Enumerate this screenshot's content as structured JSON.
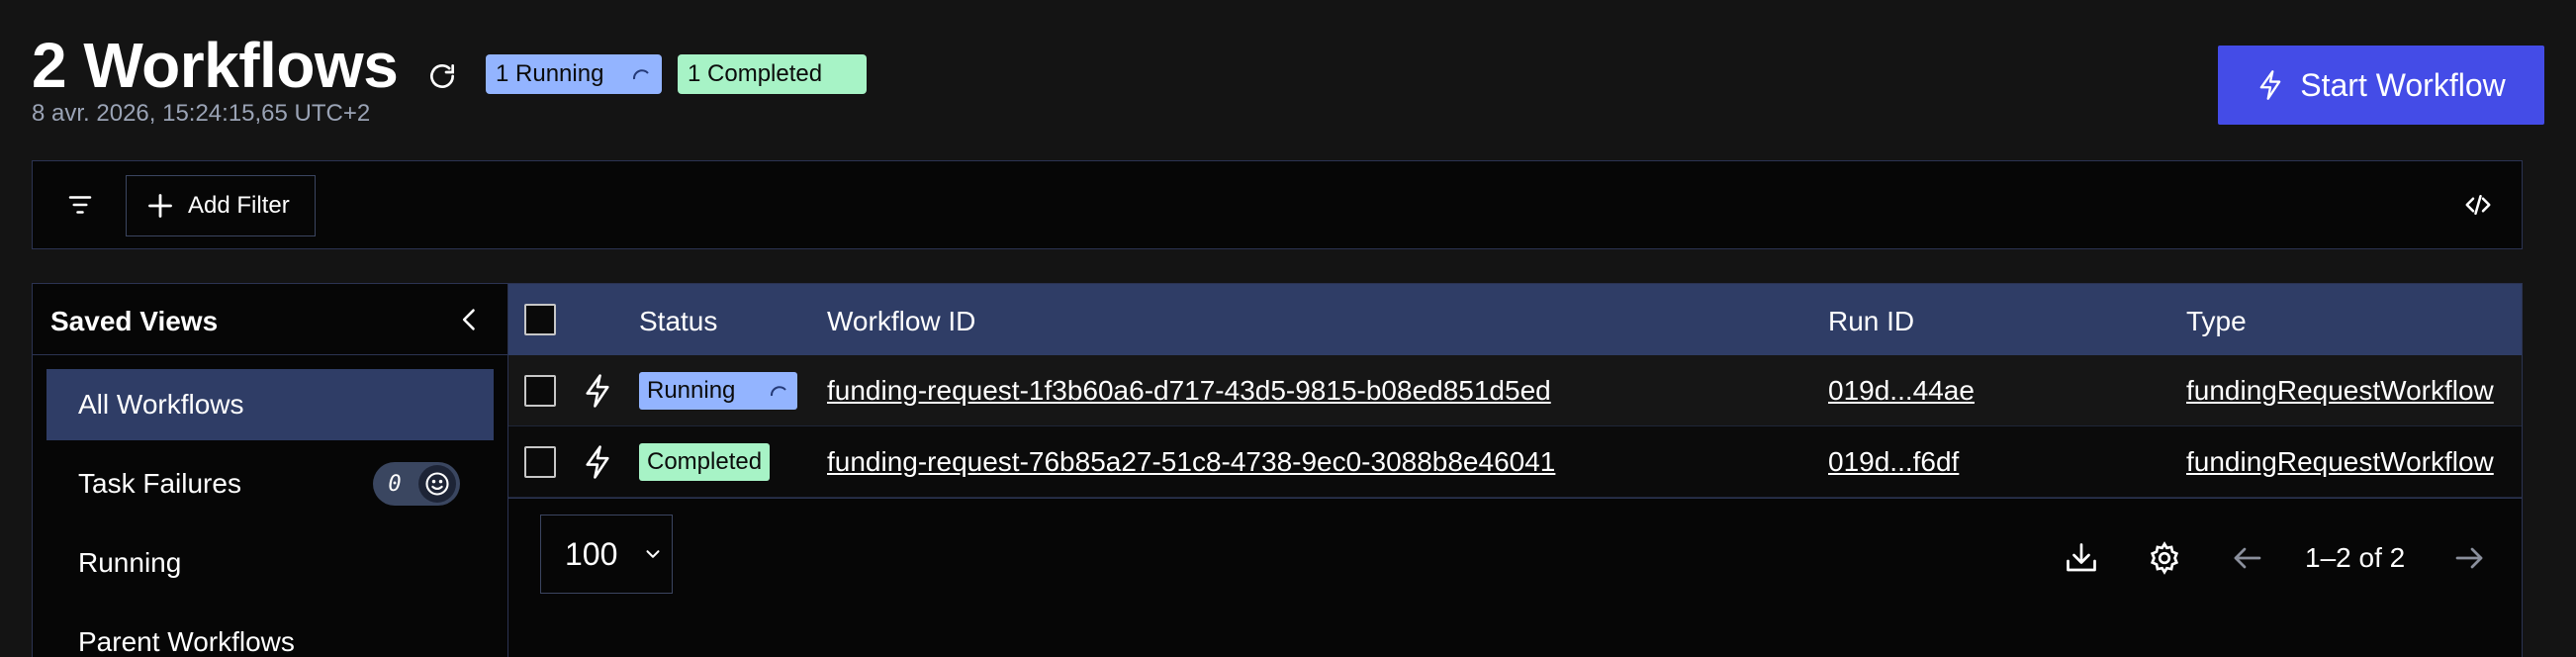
{
  "header": {
    "title": "2 Workflows",
    "timestamp": "8 avr. 2026, 15:24:15,65 UTC+2",
    "running_pill": "1 Running",
    "completed_pill": "1 Completed",
    "start_button": "Start Workflow"
  },
  "filter_bar": {
    "add_filter": "Add Filter"
  },
  "sidebar": {
    "title": "Saved Views",
    "items": [
      {
        "label": "All Workflows",
        "active": true
      },
      {
        "label": "Task Failures",
        "toggle_value": "0"
      },
      {
        "label": "Running"
      },
      {
        "label": "Parent Workflows"
      }
    ]
  },
  "table": {
    "columns": [
      "Status",
      "Workflow ID",
      "Run ID",
      "Type"
    ],
    "rows": [
      {
        "status": "Running",
        "workflow_id": "funding-request-1f3b60a6-d717-43d5-9815-b08ed851d5ed",
        "run_id": "019d...44ae",
        "type": "fundingRequestWorkflow"
      },
      {
        "status": "Completed",
        "workflow_id": "funding-request-76b85a27-51c8-4738-9ec0-3088b8e46041",
        "run_id": "019d...f6df",
        "type": "fundingRequestWorkflow"
      }
    ],
    "page_size": "100",
    "range": "1–2 of 2"
  },
  "colors": {
    "running": "#93b4ff",
    "completed": "#a7f3c6",
    "accent": "#444ce7",
    "header_row": "#2f3d66"
  },
  "icons": [
    "refresh-icon",
    "running-spinner-icon",
    "bolt-icon",
    "filter-icon",
    "plus-icon",
    "code-icon",
    "chevron-left-icon",
    "smiley-icon",
    "chevron-down-icon",
    "download-icon",
    "gear-icon",
    "arrow-left-icon",
    "arrow-right-icon"
  ]
}
